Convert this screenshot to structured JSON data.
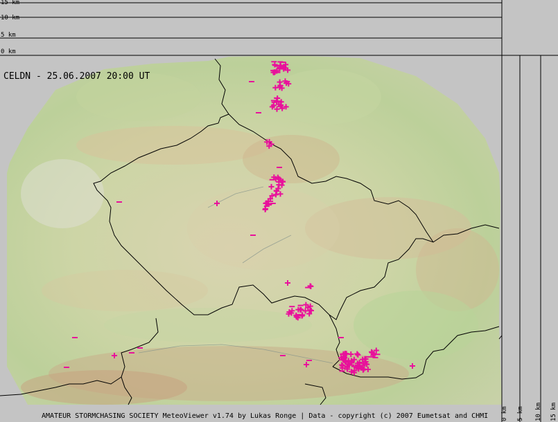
{
  "map": {
    "title": "CELDN - 25.06.2007  20:00 UT",
    "credits": "AMATEUR STORMCHASING SOCIETY MeteoViewer v1.74 by Lukas Ronge | Data - copyright (c) 2007 Eumetsat and CHMI",
    "colors": {
      "background": "#c4c4c4",
      "lightning": "#e8119b",
      "border": "#000000",
      "terrain_base": "#cfd6a6"
    }
  },
  "altitude_scale_top": {
    "labels": [
      "15 km",
      "10 km",
      "5 km",
      "0 km"
    ]
  },
  "altitude_scale_right": {
    "labels": [
      "0 km",
      "5 km",
      "10 km",
      "15 km"
    ]
  }
}
